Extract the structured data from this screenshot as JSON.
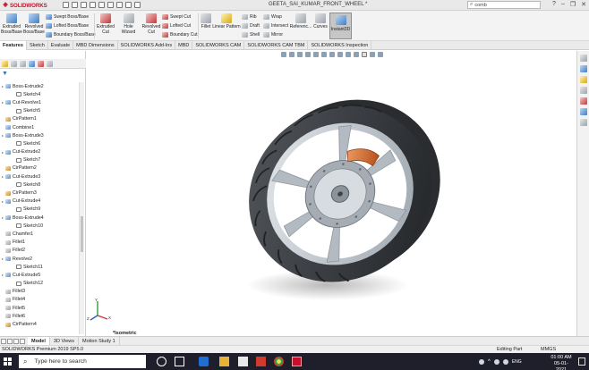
{
  "window": {
    "app_logo": "SOLIDWORKS",
    "title": "GEETA_SAI_KUMAR_FRONT_WHEEL *",
    "search_value": "comb"
  },
  "ribbon": {
    "extruded_boss": "Extruded\nBoss/Base",
    "revolved_boss": "Revolved\nBoss/Base",
    "swept_boss": "Swept Boss/Base",
    "lofted_boss": "Lofted Boss/Base",
    "boundary_boss": "Boundary Boss/Base",
    "extruded_cut": "Extruded\nCut",
    "hole_wizard": "Hole Wizard",
    "revolved_cut": "Revolved\nCut",
    "swept_cut": "Swept Cut",
    "lofted_cut": "Lofted Cut",
    "boundary_cut": "Boundary Cut",
    "fillet": "Fillet",
    "linear_pattern": "Linear Pattern",
    "rib": "Rib",
    "draft": "Draft",
    "shell": "Shell",
    "wrap": "Wrap",
    "intersect": "Intersect",
    "mirror": "Mirror",
    "reference": "Referenc...",
    "curves": "Curves",
    "instant3d": "Instant3D"
  },
  "tabs": [
    "Features",
    "Sketch",
    "Evaluate",
    "MBD Dimensions",
    "SOLIDWORKS Add-Ins",
    "MBD",
    "SOLIDWORKS CAM",
    "SOLIDWORKS CAM TBM",
    "SOLIDWORKS Inspection"
  ],
  "feature_tree": [
    {
      "label": "Boss-Extrude2",
      "type": "feat",
      "expand": true,
      "indent": 0
    },
    {
      "label": "Sketch4",
      "type": "sketch",
      "expand": false,
      "indent": 1
    },
    {
      "label": "Cut-Revolve1",
      "type": "feat",
      "expand": true,
      "indent": 0
    },
    {
      "label": "Sketch5",
      "type": "sketch",
      "expand": false,
      "indent": 1
    },
    {
      "label": "CirPattern1",
      "type": "pattern",
      "expand": false,
      "indent": 0
    },
    {
      "label": "Combine1",
      "type": "feat",
      "expand": false,
      "indent": 0
    },
    {
      "label": "Boss-Extrude3",
      "type": "feat",
      "expand": true,
      "indent": 0
    },
    {
      "label": "Sketch6",
      "type": "sketch",
      "expand": false,
      "indent": 1
    },
    {
      "label": "Cut-Extrude2",
      "type": "feat",
      "expand": true,
      "indent": 0
    },
    {
      "label": "Sketch7",
      "type": "sketch",
      "expand": false,
      "indent": 1
    },
    {
      "label": "CirPattern2",
      "type": "pattern",
      "expand": false,
      "indent": 0
    },
    {
      "label": "Cut-Extrude3",
      "type": "feat",
      "expand": true,
      "indent": 0
    },
    {
      "label": "Sketch8",
      "type": "sketch",
      "expand": false,
      "indent": 1
    },
    {
      "label": "CirPattern3",
      "type": "pattern",
      "expand": false,
      "indent": 0
    },
    {
      "label": "Cut-Extrude4",
      "type": "feat",
      "expand": true,
      "indent": 0
    },
    {
      "label": "Sketch9",
      "type": "sketch",
      "expand": false,
      "indent": 1
    },
    {
      "label": "Boss-Extrude4",
      "type": "feat",
      "expand": true,
      "indent": 0
    },
    {
      "label": "Sketch10",
      "type": "sketch",
      "expand": false,
      "indent": 1
    },
    {
      "label": "Chamfer1",
      "type": "fillet",
      "expand": false,
      "indent": 0
    },
    {
      "label": "Fillet1",
      "type": "fillet",
      "expand": false,
      "indent": 0
    },
    {
      "label": "Fillet2",
      "type": "fillet",
      "expand": false,
      "indent": 0
    },
    {
      "label": "Revolve2",
      "type": "feat",
      "expand": true,
      "indent": 0
    },
    {
      "label": "Sketch11",
      "type": "sketch",
      "expand": false,
      "indent": 1
    },
    {
      "label": "Cut-Extrude5",
      "type": "feat",
      "expand": true,
      "indent": 0
    },
    {
      "label": "Sketch12",
      "type": "sketch",
      "expand": false,
      "indent": 1
    },
    {
      "label": "Fillet3",
      "type": "fillet",
      "expand": false,
      "indent": 0
    },
    {
      "label": "Fillet4",
      "type": "fillet",
      "expand": false,
      "indent": 0
    },
    {
      "label": "Fillet5",
      "type": "fillet",
      "expand": false,
      "indent": 0
    },
    {
      "label": "Fillet6",
      "type": "fillet",
      "expand": false,
      "indent": 0
    },
    {
      "label": "CirPattern4",
      "type": "pattern",
      "expand": false,
      "indent": 0
    }
  ],
  "viewport": {
    "view_name": "*Isometric",
    "triad_axes": [
      "X",
      "Y",
      "Z"
    ],
    "colors": {
      "tire": "#3a3d41",
      "rim": "#c7cdd3",
      "disc": "#9aa1a8",
      "caliper": "#d9692b"
    }
  },
  "bottom_tabs": [
    "Model",
    "3D Views",
    "Motion Study 1"
  ],
  "status": {
    "product": "SOLIDWORKS Premium 2019 SP5.0",
    "mode": "Editing Part",
    "units": "MMGS"
  },
  "taskbar": {
    "search_placeholder": "Type here to search",
    "language": "ENG",
    "time": "01:00 AM",
    "date": "05-01-2021"
  }
}
